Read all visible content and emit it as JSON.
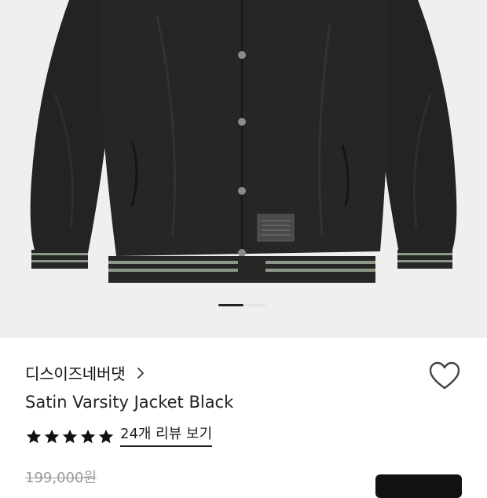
{
  "gallery": {
    "image": "satin-varsity-jacket-black",
    "label_text": "WORLD UNIFIED FOR THE WORLD",
    "slide_count": 2,
    "active_slide": 1
  },
  "product": {
    "brand": "디스이즈네버댓",
    "name": "Satin Varsity Jacket Black",
    "rating_stars": 5,
    "reviews_link": "24개 리뷰 보기",
    "original_price": "199,000원"
  },
  "colors": {
    "background": "#ffffff",
    "gallery_bg": "#efefef",
    "text": "#111111",
    "muted": "#9a9a9a",
    "cta": "#111111"
  },
  "icons": {
    "brand_chevron": "chevron-right-icon",
    "wishlist": "heart-outline-icon",
    "star": "star-filled-icon"
  }
}
